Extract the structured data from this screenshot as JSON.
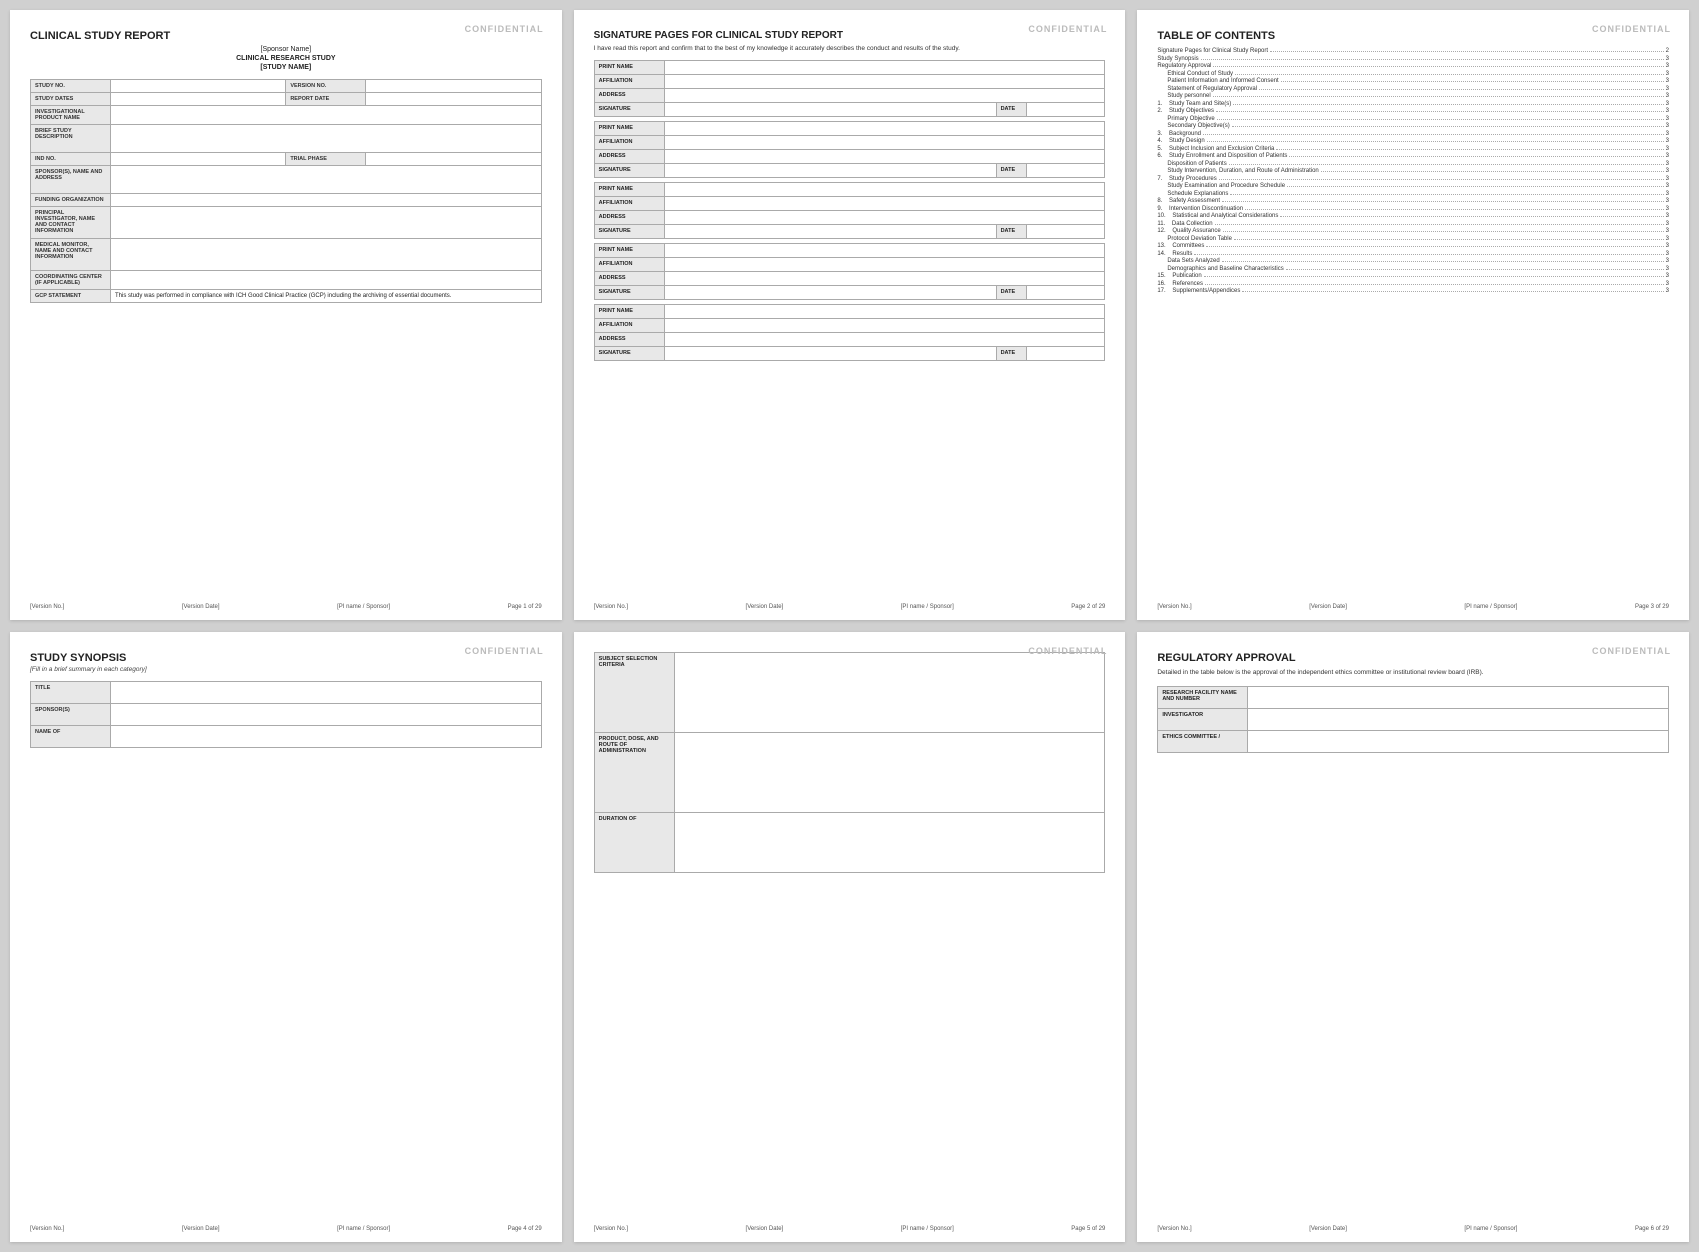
{
  "pages": [
    {
      "id": "page1",
      "confidential": "CONFIDENTIAL",
      "title": "CLINICAL STUDY REPORT",
      "sponsor_name": "[Sponsor Name]",
      "research_study": "CLINICAL RESEARCH STUDY",
      "study_name": "[STUDY NAME]",
      "fields": [
        {
          "label": "STUDY NO.",
          "value": "",
          "colspan": 1,
          "right_label": "VERSION NO.",
          "right_value": ""
        },
        {
          "label": "STUDY DATES",
          "value": "",
          "colspan": 1,
          "right_label": "REPORT DATE",
          "right_value": ""
        },
        {
          "label": "INVESTIGATIONAL PRODUCT NAME",
          "value": "",
          "full": true
        },
        {
          "label": "BRIEF STUDY DESCRIPTION",
          "value": "",
          "full": true,
          "tall": true
        },
        {
          "label": "IND NO.",
          "value": "",
          "colspan": 1,
          "right_label": "TRIAL PHASE",
          "right_value": ""
        },
        {
          "label": "SPONSOR(S), NAME AND ADDRESS",
          "value": "",
          "full": true,
          "tall": true
        },
        {
          "label": "FUNDING ORGANIZATION",
          "value": "",
          "full": true
        },
        {
          "label": "PRINCIPAL INVESTIGATOR, NAME AND CONTACT INFORMATION",
          "value": "",
          "full": true,
          "tall": true
        },
        {
          "label": "MEDICAL MONITOR, NAME AND CONTACT INFORMATION",
          "value": "",
          "full": true,
          "tall": true
        },
        {
          "label": "COORDINATING CENTER (if applicable)",
          "value": "",
          "full": true
        },
        {
          "label": "GCP STATEMENT",
          "value": "This study was performed in compliance with ICH Good Clinical Practice (GCP) including the archiving of essential documents.",
          "full": true,
          "gcptext": true
        }
      ],
      "footer": {
        "left": "[Version No.]",
        "left2": "[Version Date]",
        "center": "[PI name / Sponsor]",
        "right": "Page 1 of 29"
      }
    },
    {
      "id": "page2",
      "confidential": "CONFIDENTIAL",
      "title": "SIGNATURE PAGES FOR CLINICAL STUDY REPORT",
      "subtitle": "I have read this report and confirm that to the best of my knowledge it accurately describes the conduct and results of the study.",
      "sig_groups": [
        {
          "fields": [
            "PRINT NAME",
            "AFFILIATION",
            "ADDRESS"
          ],
          "has_sig_date": true
        },
        {
          "fields": [
            "PRINT NAME",
            "AFFILIATION",
            "ADDRESS"
          ],
          "has_sig_date": true
        },
        {
          "fields": [
            "PRINT NAME",
            "AFFILIATION",
            "ADDRESS"
          ],
          "has_sig_date": true
        },
        {
          "fields": [
            "PRINT NAME",
            "AFFILIATION",
            "ADDRESS"
          ],
          "has_sig_date": true
        },
        {
          "fields": [
            "PRINT NAME",
            "AFFILIATION",
            "ADDRESS"
          ],
          "has_sig_date": true
        }
      ],
      "footer": {
        "left": "[Version No.]",
        "left2": "[Version Date]",
        "center": "[PI name / Sponsor]",
        "right": "Page 2 of 29"
      }
    },
    {
      "id": "page3",
      "confidential": "CONFIDENTIAL",
      "title": "TABLE OF CONTENTS",
      "toc": [
        {
          "label": "Signature Pages for Clinical Study Report",
          "page": "2",
          "indent": 0
        },
        {
          "label": "Study Synopsis",
          "page": "3",
          "indent": 0
        },
        {
          "label": "Regulatory Approval",
          "page": "3",
          "indent": 0
        },
        {
          "label": "Ethical Conduct of Study",
          "page": "3",
          "indent": 1
        },
        {
          "label": "Patient Information and Informed Consent",
          "page": "3",
          "indent": 1
        },
        {
          "label": "Statement of Regulatory Approval",
          "page": "3",
          "indent": 1
        },
        {
          "label": "Study personnel",
          "page": "3",
          "indent": 1
        },
        {
          "label": "1.    Study Team and Site(s)",
          "page": "3",
          "indent": 0
        },
        {
          "label": "2.    Study Objectives",
          "page": "3",
          "indent": 0
        },
        {
          "label": "Primary Objective",
          "page": "3",
          "indent": 1
        },
        {
          "label": "Secondary Objective(s)",
          "page": "3",
          "indent": 1
        },
        {
          "label": "3.    Background",
          "page": "3",
          "indent": 0
        },
        {
          "label": "4.    Study Design",
          "page": "3",
          "indent": 0
        },
        {
          "label": "5.    Subject Inclusion and Exclusion Criteria",
          "page": "3",
          "indent": 0
        },
        {
          "label": "6.    Study Enrollment and Disposition of Patients",
          "page": "3",
          "indent": 0
        },
        {
          "label": "Disposition of Patients",
          "page": "3",
          "indent": 1
        },
        {
          "label": "Study Intervention, Duration, and Route of Administration",
          "page": "3",
          "indent": 1
        },
        {
          "label": "7.    Study Procedures",
          "page": "3",
          "indent": 0
        },
        {
          "label": "Study Examination and Procedure Schedule",
          "page": "3",
          "indent": 1
        },
        {
          "label": "Schedule Explanations",
          "page": "3",
          "indent": 1
        },
        {
          "label": "8.    Safety Assessment",
          "page": "3",
          "indent": 0
        },
        {
          "label": "9.    Intervention Discontinuation",
          "page": "3",
          "indent": 0
        },
        {
          "label": "10.    Statistical and Analytical Considerations",
          "page": "3",
          "indent": 0
        },
        {
          "label": "11.    Data Collection",
          "page": "3",
          "indent": 0
        },
        {
          "label": "12.    Quality Assurance",
          "page": "3",
          "indent": 0
        },
        {
          "label": "Protocol Deviation Table",
          "page": "3",
          "indent": 1
        },
        {
          "label": "13.    Committees",
          "page": "3",
          "indent": 0
        },
        {
          "label": "14.    Results",
          "page": "3",
          "indent": 0
        },
        {
          "label": "Data Sets Analyzed",
          "page": "3",
          "indent": 1
        },
        {
          "label": "Demographics and Baseline Characteristics",
          "page": "3",
          "indent": 1
        },
        {
          "label": "15.    Publication",
          "page": "3",
          "indent": 0
        },
        {
          "label": "16.    References",
          "page": "3",
          "indent": 0
        },
        {
          "label": "17.    Supplements/Appendices",
          "page": "3",
          "indent": 0
        }
      ],
      "footer": {
        "left": "[Version No.]",
        "left2": "[Version Date]",
        "center": "[PI name / Sponsor]",
        "right": "Page 3 of 29"
      }
    },
    {
      "id": "page4",
      "confidential": "CONFIDENTIAL",
      "title": "STUDY SYNOPSIS",
      "subtitle": "[Fill in a brief summary in each category]",
      "fields": [
        {
          "label": "TITLE",
          "value": ""
        },
        {
          "label": "SPONSOR(S)",
          "value": ""
        },
        {
          "label": "NAME OF",
          "value": ""
        }
      ],
      "footer": {
        "left": "[Version No.]",
        "left2": "[Version Date]",
        "center": "[PI name / Sponsor]",
        "right": "Page 4 of 29"
      }
    },
    {
      "id": "page5",
      "confidential": "CONFIDENTIAL",
      "fields": [
        {
          "label": "SUBJECT SELECTION CRITERIA",
          "value": "",
          "tall": true
        },
        {
          "label": "PRODUCT, DOSE, AND ROUTE OF ADMINISTRATION",
          "value": "",
          "tall": true
        },
        {
          "label": "DURATION OF",
          "value": "",
          "tall": true
        }
      ],
      "footer": {
        "left": "[Version No.]",
        "left2": "[Version Date]",
        "center": "[PI name / Sponsor]",
        "right": "Page 5 of 29"
      }
    },
    {
      "id": "page6",
      "confidential": "CONFIDENTIAL",
      "title": "REGULATORY APPROVAL",
      "desc": "Detailed in the table below is the approval of the independent ethics committee or institutional review board (IRB).",
      "fields": [
        {
          "label": "RESEARCH FACILITY NAME AND NUMBER",
          "value": ""
        },
        {
          "label": "INVESTIGATOR",
          "value": ""
        },
        {
          "label": "ETHICS COMMITTEE /",
          "value": ""
        }
      ],
      "footer": {
        "left": "[Version No.]",
        "left2": "[Version Date]",
        "center": "[PI name / Sponsor]",
        "right": "Page 6 of 29"
      }
    }
  ]
}
